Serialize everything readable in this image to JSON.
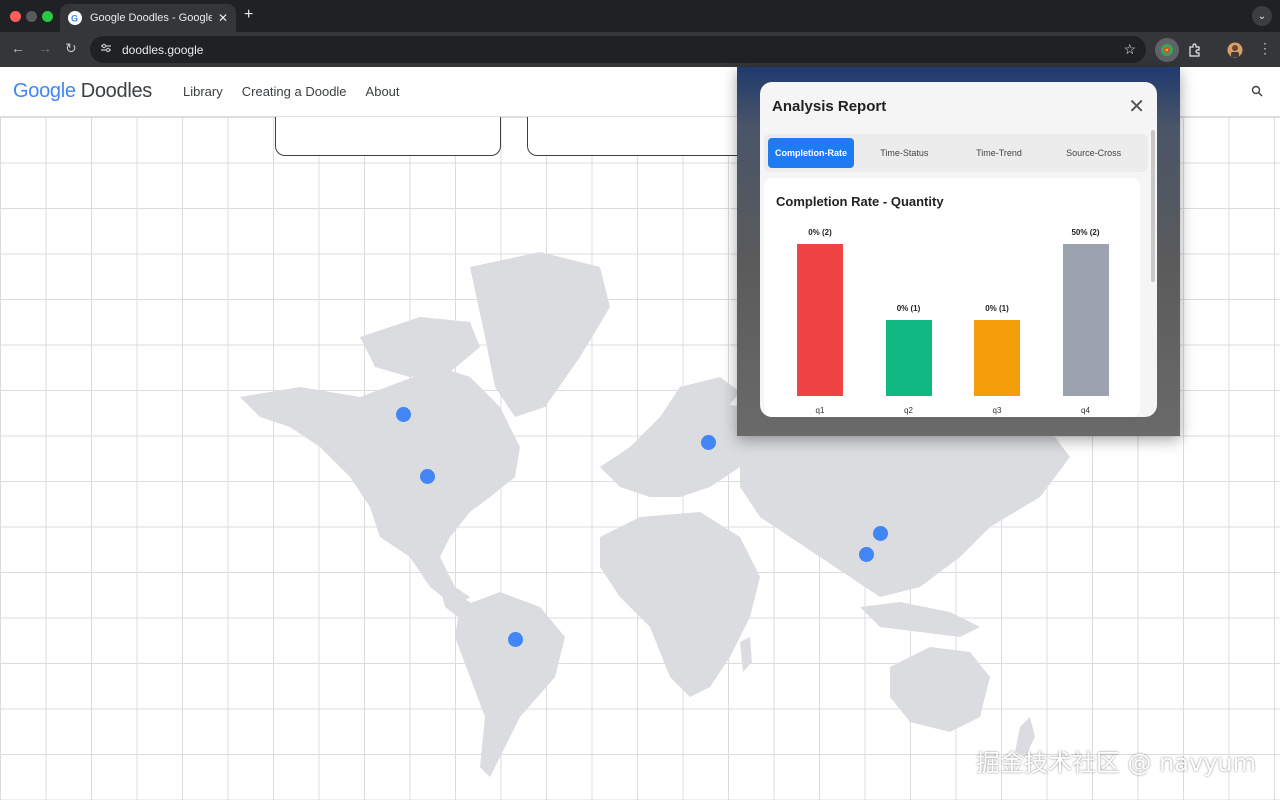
{
  "browser": {
    "tab_title": "Google Doodles - Google's S",
    "url": "doodles.google",
    "new_tab_symbol": "+",
    "close_symbol": "✕"
  },
  "site": {
    "logo_google": "Google",
    "logo_doodles": "Doodles",
    "nav": [
      {
        "label": "Library"
      },
      {
        "label": "Creating a Doodle"
      },
      {
        "label": "About"
      }
    ]
  },
  "popup": {
    "title": "Analysis Report",
    "tabs": [
      {
        "label": "Completion-Rate",
        "active": true
      },
      {
        "label": "Time-Status",
        "active": false
      },
      {
        "label": "Time-Trend",
        "active": false
      },
      {
        "label": "Source-Cross",
        "active": false
      }
    ]
  },
  "chart_data": {
    "type": "bar",
    "title": "Completion Rate - Quantity",
    "categories": [
      "q1",
      "q2",
      "q3",
      "q4"
    ],
    "quantities": [
      2,
      1,
      1,
      2
    ],
    "value_labels": [
      "0% (2)",
      "0% (1)",
      "0% (1)",
      "50% (2)"
    ],
    "colors": [
      "#ef4444",
      "#10b981",
      "#f59e0b",
      "#9ca3af"
    ],
    "xlabel": "",
    "ylabel": "",
    "ylim": [
      0,
      2
    ]
  },
  "watermark": "掘金技术社区 @ navyum",
  "colors": {
    "accent": "#1e7bf2",
    "map_dot": "#4285f4",
    "map_land": "#dadce0"
  }
}
